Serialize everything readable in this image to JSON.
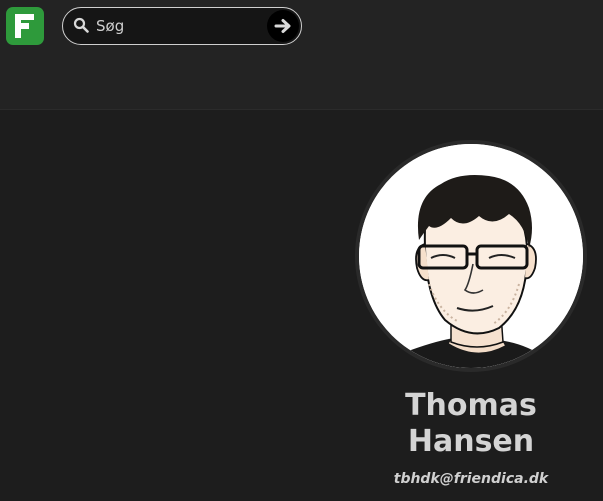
{
  "header": {
    "logo_icon": "friendica-logo-icon",
    "brand_color": "#2e9a3b",
    "search": {
      "placeholder": "Søg",
      "search_icon": "magnifier-icon",
      "submit_icon": "arrow-right-icon"
    }
  },
  "profile": {
    "name": "Thomas Hansen",
    "address": "tbhdk@friendica.dk",
    "avatar_icon": "profile-photo"
  }
}
